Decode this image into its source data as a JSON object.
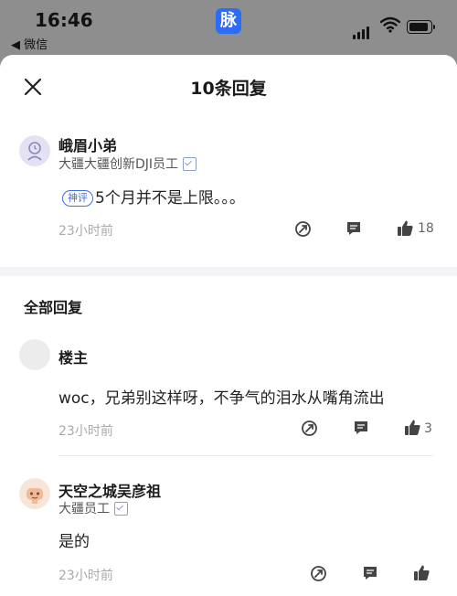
{
  "status_bar": {
    "time": "16:46",
    "back_app": "◀ 微信",
    "app_badge": "脉"
  },
  "header": {
    "title": "10条回复"
  },
  "top_comment": {
    "author": "峨眉小弟",
    "subtitle": "大疆大疆创新DJI员工",
    "badge": "神评",
    "text": "5个月并不是上限。。。",
    "time": "23小时前",
    "likes": "18"
  },
  "section": {
    "title": "全部回复"
  },
  "replies": [
    {
      "author": "楼主",
      "subtitle": "",
      "text": "woc，兄弟别这样呀，不争气的泪水从嘴角流出",
      "time": "23小时前",
      "likes": "3"
    },
    {
      "author": "天空之城吴彦祖",
      "subtitle": "大疆员工",
      "text": "是的",
      "time": "23小时前",
      "likes": ""
    }
  ],
  "icons": {
    "close": "close-icon",
    "share": "share-icon",
    "comment": "comment-icon",
    "like": "thumbs-up-icon",
    "verified": "verified-icon"
  },
  "colors": {
    "accent": "#3d6fe0",
    "muted": "#aaaaaa",
    "app_badge": "#2d6cf6"
  }
}
